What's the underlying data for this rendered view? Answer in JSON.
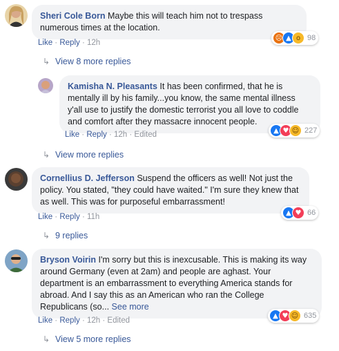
{
  "comments": [
    {
      "author": "Sheri Cole Born",
      "text": "Maybe this will teach him not to trespass numerous times at the location.",
      "actions": {
        "like": "Like",
        "reply": "Reply",
        "time": "12h"
      },
      "reactions": {
        "icons": [
          "angry-icon",
          "like-icon",
          "wow-icon"
        ],
        "count": "98"
      }
    },
    {
      "author": "Kamisha N. Pleasants",
      "text": "It has been confirmed, that he is mentally ill by his family...you know, the same mental illness y'all use to justify the domestic terrorist you all love to coddle and comfort after they massacre innocent people.",
      "actions": {
        "like": "Like",
        "reply": "Reply",
        "time": "12h",
        "edited": "Edited"
      },
      "reactions": {
        "icons": [
          "like-icon",
          "love-icon",
          "haha-icon"
        ],
        "count": "227"
      }
    },
    {
      "author": "Cornellius D. Jefferson",
      "text": "Suspend the officers as well! Not just the policy. You stated, \"they could have waited.\" I'm sure they knew that as well. This was for purposeful embarrassment!",
      "actions": {
        "like": "Like",
        "reply": "Reply",
        "time": "11h"
      },
      "reactions": {
        "icons": [
          "like-icon",
          "love-icon"
        ],
        "count": "66"
      }
    },
    {
      "author": "Bryson Voirin",
      "text": "I'm sorry but this is inexcusable. This is making its way around Germany (even at 2am) and people are aghast. Your department is an embarrassment to everything America stands for abroad. And I say this as an American who ran the College Republicans (so...",
      "see_more": "See more",
      "actions": {
        "like": "Like",
        "reply": "Reply",
        "time": "12h",
        "edited": "Edited"
      },
      "reactions": {
        "icons": [
          "like-icon",
          "love-icon",
          "haha-icon"
        ],
        "count": "635"
      }
    }
  ],
  "view_more": [
    "View 8 more replies",
    "View more replies",
    "9 replies",
    "View 5 more replies"
  ],
  "colors": {
    "link": "#385898",
    "bubble": "#f2f3f5",
    "meta": "#90949c"
  }
}
